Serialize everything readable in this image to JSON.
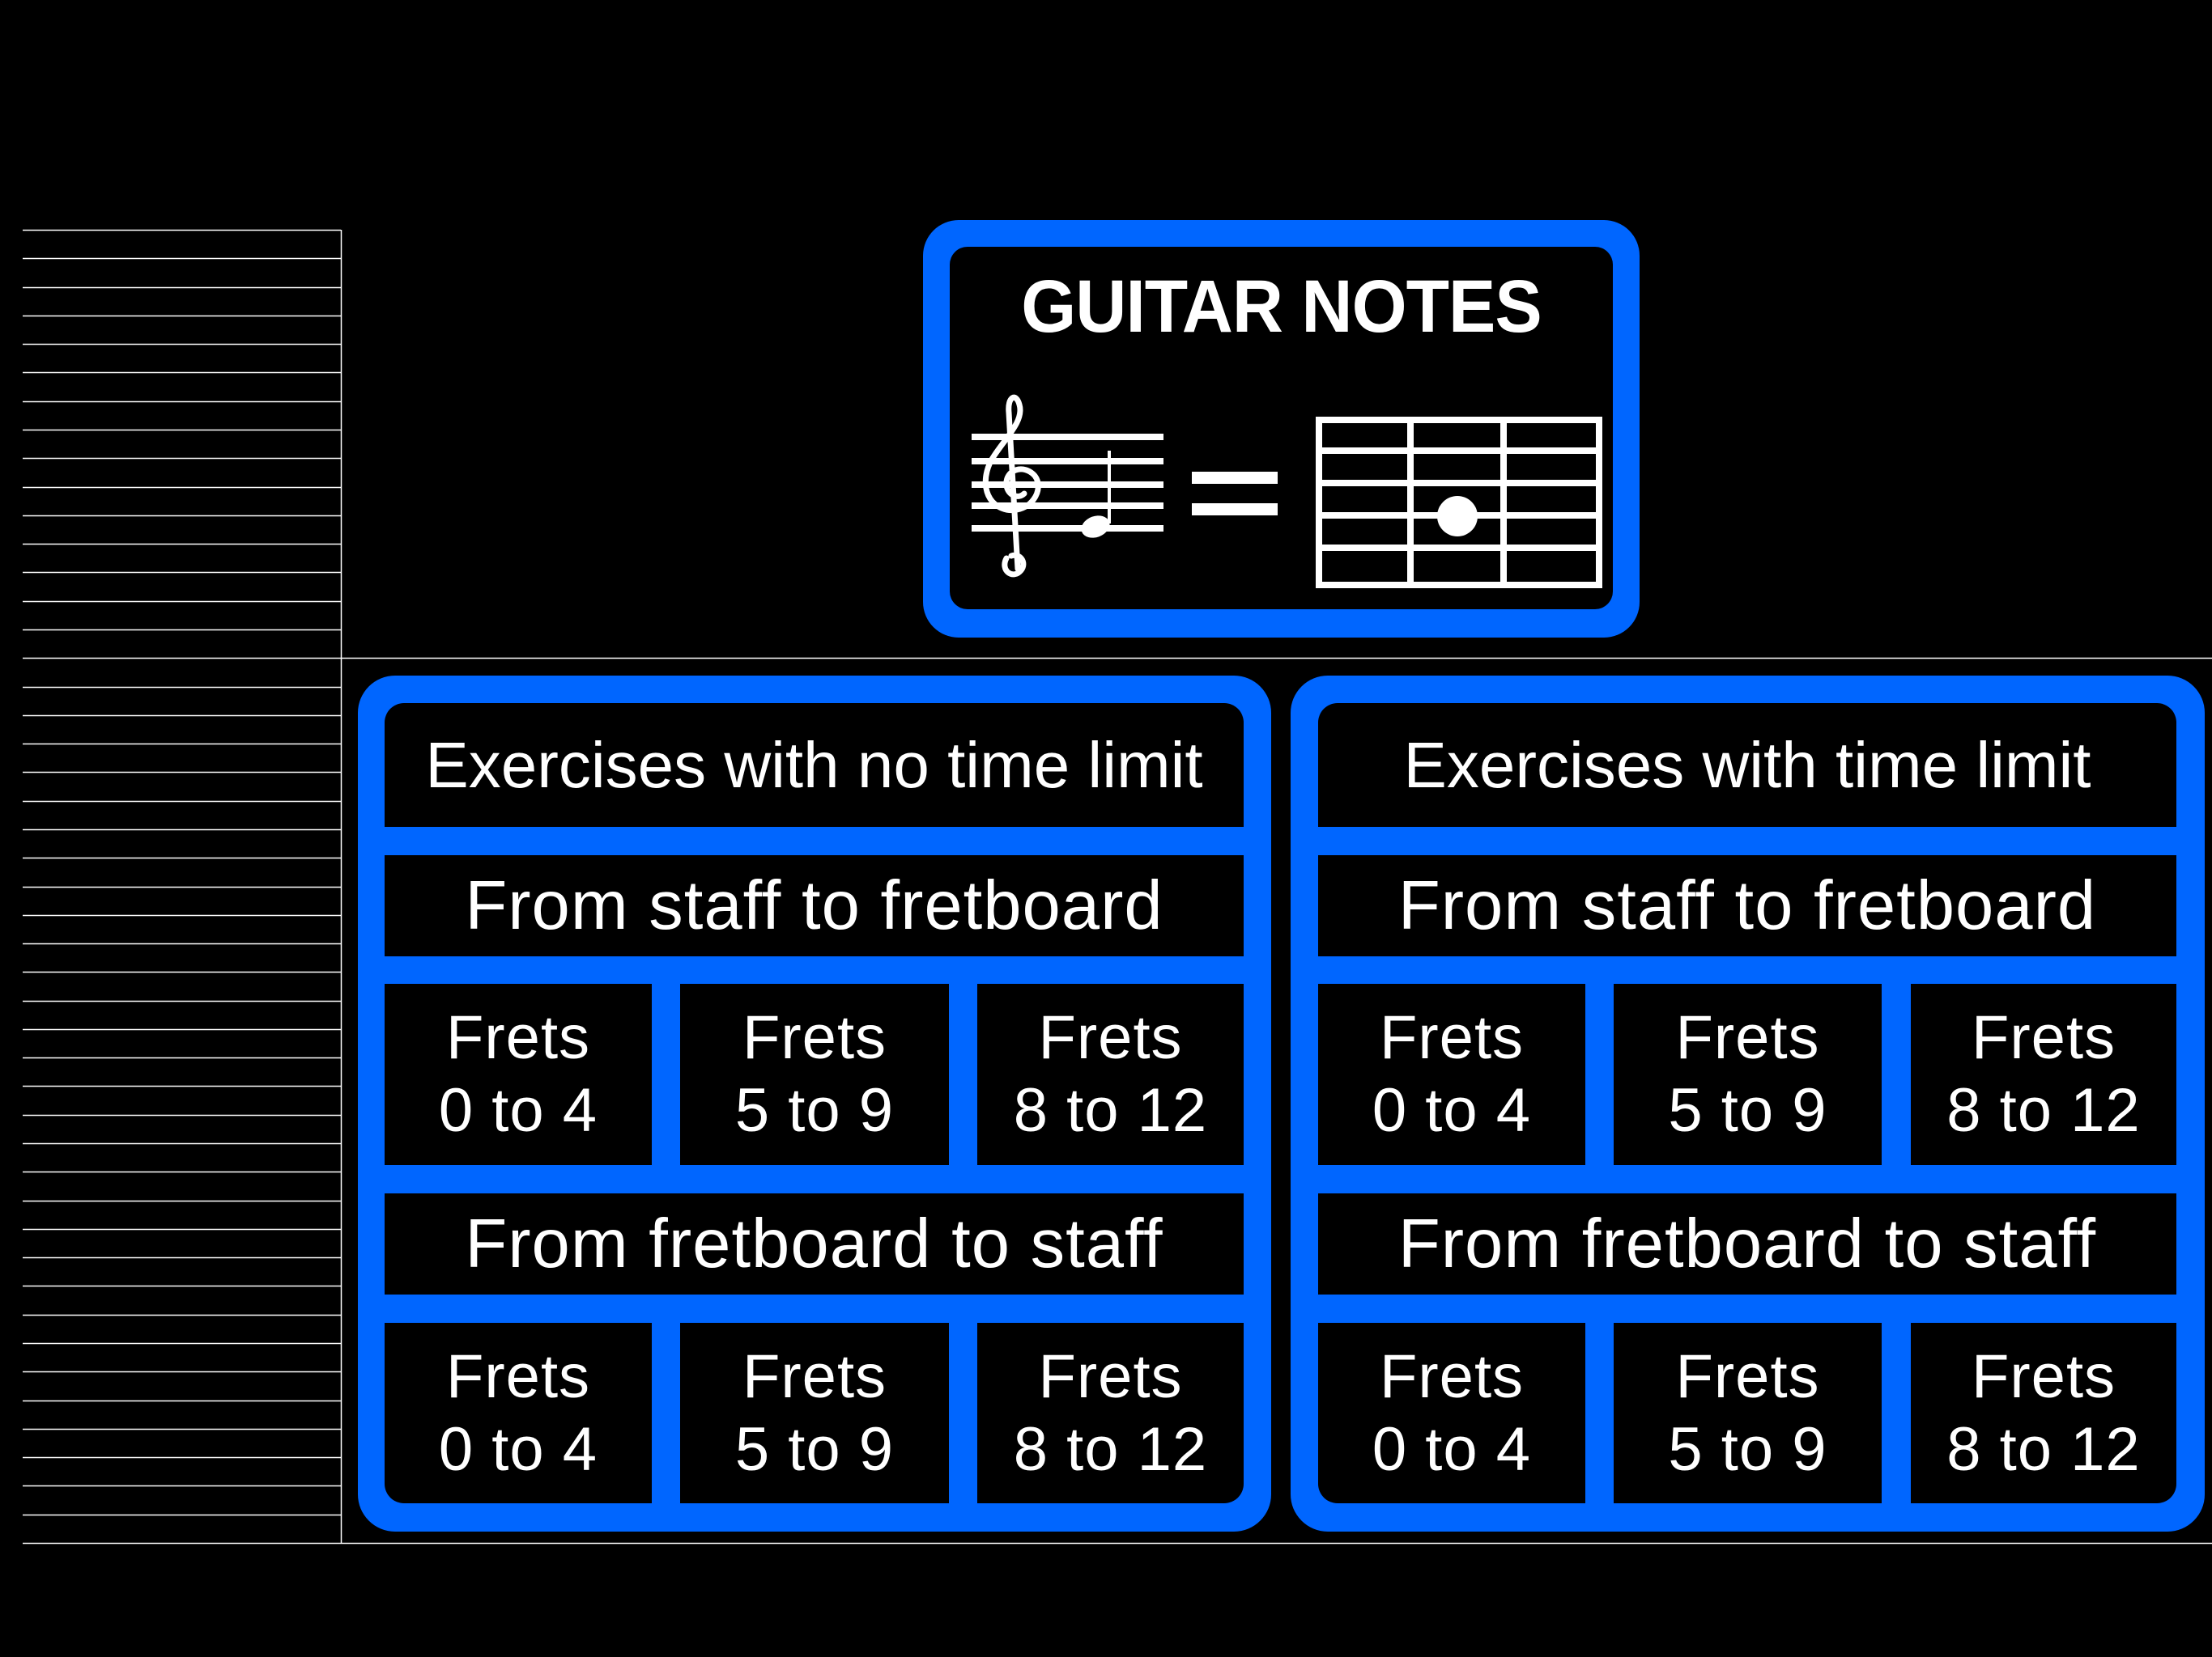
{
  "app": {
    "title": "GUITAR NOTES",
    "accent_color": "#0066ff",
    "background_color": "#000000",
    "icons": {
      "staff": "treble-clef-staff-icon",
      "equals": "equals-icon",
      "fretboard": "fretboard-icon"
    }
  },
  "panels": [
    {
      "header": "Exercises with no time limit",
      "sections": [
        {
          "label": "From staff to fretboard",
          "ranges": [
            {
              "line1": "Frets",
              "line2": "0 to 4"
            },
            {
              "line1": "Frets",
              "line2": "5 to 9"
            },
            {
              "line1": "Frets",
              "line2": "8 to 12"
            }
          ]
        },
        {
          "label": "From fretboard to staff",
          "ranges": [
            {
              "line1": "Frets",
              "line2": "0 to 4"
            },
            {
              "line1": "Frets",
              "line2": "5 to 9"
            },
            {
              "line1": "Frets",
              "line2": "8 to 12"
            }
          ]
        }
      ]
    },
    {
      "header": "Exercises with time limit",
      "sections": [
        {
          "label": "From staff to fretboard",
          "ranges": [
            {
              "line1": "Frets",
              "line2": "0 to 4"
            },
            {
              "line1": "Frets",
              "line2": "5 to 9"
            },
            {
              "line1": "Frets",
              "line2": "8 to 12"
            }
          ]
        },
        {
          "label": "From fretboard to staff",
          "ranges": [
            {
              "line1": "Frets",
              "line2": "0 to 4"
            },
            {
              "line1": "Frets",
              "line2": "5 to 9"
            },
            {
              "line1": "Frets",
              "line2": "8 to 12"
            }
          ]
        }
      ]
    }
  ]
}
